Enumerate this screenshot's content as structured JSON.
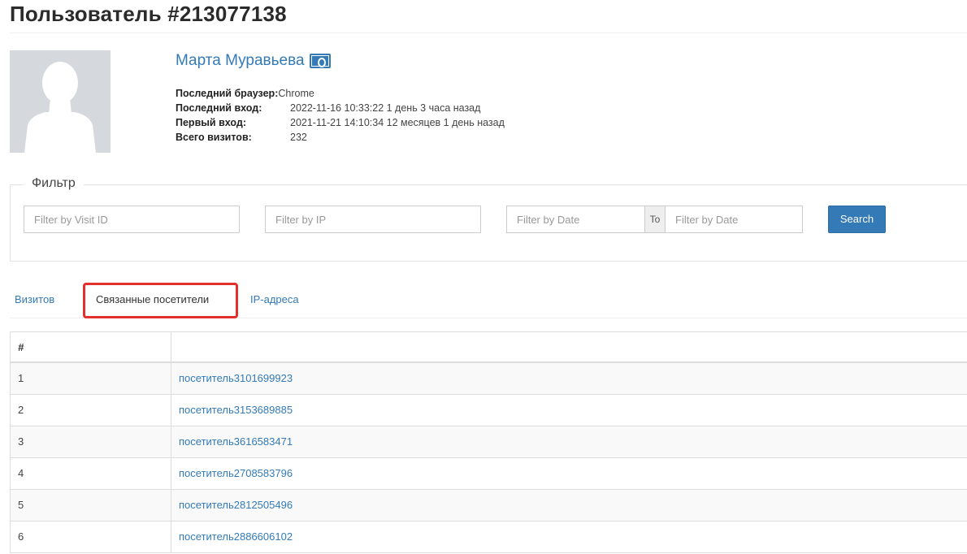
{
  "page_title": "Пользователь #213077138",
  "user": {
    "name": "Марта Муравьева",
    "browser_label": "Последний браузер:",
    "browser_value": "Chrome",
    "last_login_label": "Последний вход:",
    "last_login_value": "2022-11-16 10:33:22 1 день 3 часа назад",
    "first_login_label": "Первый вход:",
    "first_login_value": "2021-11-21 14:10:34 12 месяцев 1 день назад",
    "visits_label": "Всего визитов:",
    "visits_value": "232"
  },
  "filter": {
    "legend": "Фильтр",
    "visit_id_placeholder": "Filter by Visit ID",
    "ip_placeholder": "Filter by IP",
    "date_from_placeholder": "Filter by Date",
    "to_label": "To",
    "date_to_placeholder": "Filter by Date",
    "search_label": "Search"
  },
  "tabs": [
    {
      "label": "Визитов",
      "active": false
    },
    {
      "label": "Связанные посетители",
      "active": true
    },
    {
      "label": "IP-адреса",
      "active": false
    }
  ],
  "table": {
    "header_num": "#",
    "header_name": "",
    "rows": [
      {
        "num": "1",
        "name": "посетитель3101699923"
      },
      {
        "num": "2",
        "name": "посетитель3153689885"
      },
      {
        "num": "3",
        "name": "посетитель3616583471"
      },
      {
        "num": "4",
        "name": "посетитель2708583796"
      },
      {
        "num": "5",
        "name": "посетитель2812505496"
      },
      {
        "num": "6",
        "name": "посетитель2886606102"
      }
    ]
  },
  "colors": {
    "link": "#337ab7",
    "highlight": "#e2312c",
    "primary_button": "#337ab7"
  }
}
